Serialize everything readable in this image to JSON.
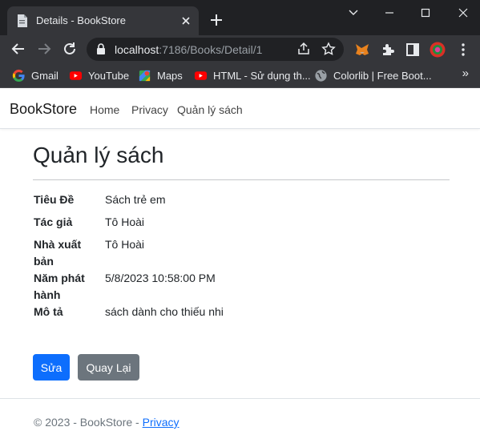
{
  "browser": {
    "tab_title": "Details - BookStore",
    "url_host": "localhost",
    "url_path": ":7186/Books/Detail/1",
    "bookmarks": [
      "Gmail",
      "YouTube",
      "Maps",
      "HTML - Sử dụng th...",
      "Colorlib | Free Boot..."
    ],
    "bookmarks_more": "»"
  },
  "site": {
    "brand": "BookStore",
    "nav": [
      "Home",
      "Privacy",
      "Quản lý sách"
    ]
  },
  "main": {
    "heading": "Quản lý sách",
    "fields": [
      {
        "label": "Tiêu Đề",
        "value": "Sách trẻ em"
      },
      {
        "label": "Tác giả",
        "value": "Tô Hoài"
      },
      {
        "label": "Nhà xuất bản",
        "value": "Tô Hoài"
      },
      {
        "label": "Năm phát hành",
        "value": "5/8/2023 10:58:00 PM"
      },
      {
        "label": "Mô tả",
        "value": "sách dành cho thiếu nhi"
      }
    ],
    "edit_label": "Sửa",
    "back_label": "Quay Lại"
  },
  "footer": {
    "text": "© 2023 - BookStore - ",
    "privacy": "Privacy"
  },
  "colors": {
    "primary": "#0d6efd",
    "secondary": "#6c757d",
    "chrome_dark": "#202124",
    "chrome_toolbar": "#35363a"
  }
}
